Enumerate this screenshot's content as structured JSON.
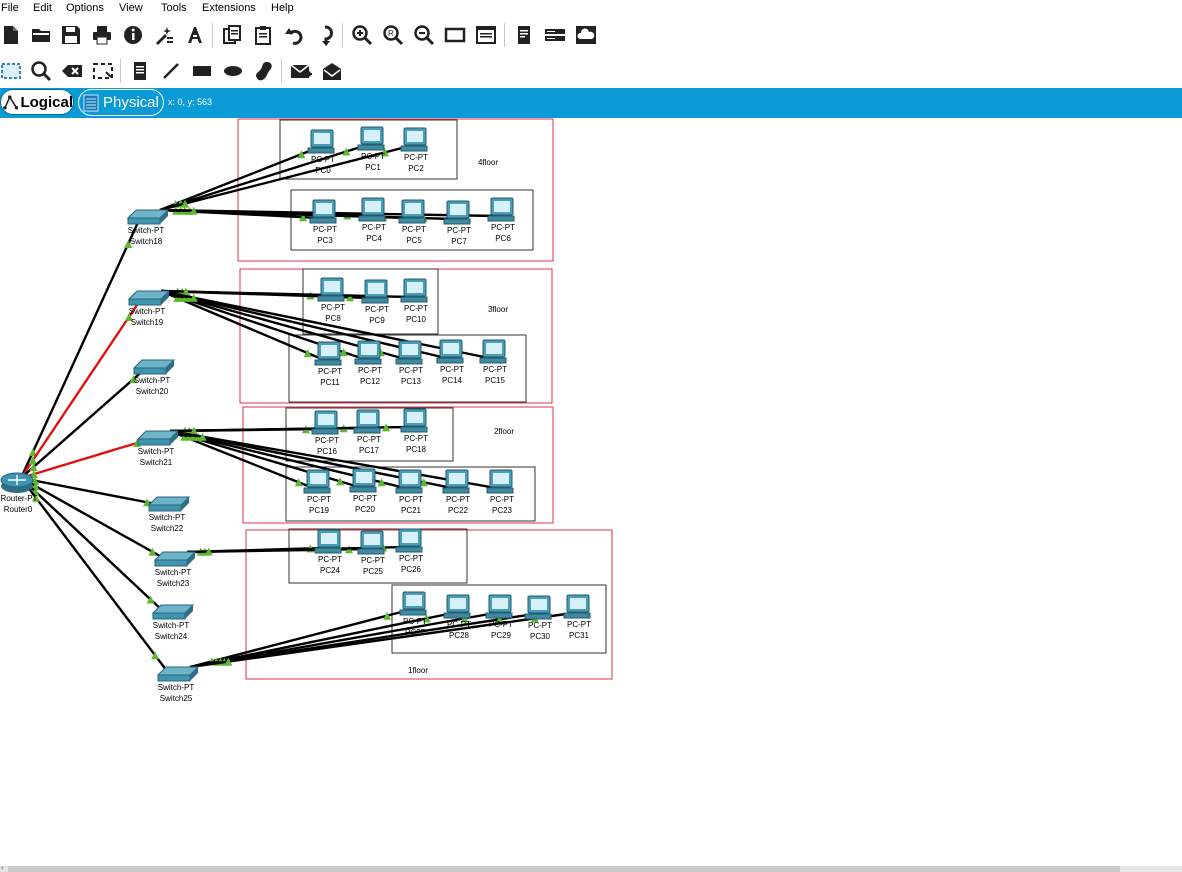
{
  "menu": [
    "File",
    "Edit",
    "Options",
    "View",
    "Tools",
    "Extensions",
    "Help"
  ],
  "toolbar1_icons": [
    "new-file-icon",
    "open-folder-icon",
    "save-icon",
    "print-icon",
    "info-icon",
    "activity-wizard-icon",
    "text-tool-icon",
    "copy-icon",
    "paste-icon",
    "undo-icon",
    "redo-icon",
    "zoom-in-icon",
    "zoom-reset-icon",
    "zoom-out-icon",
    "drawing-palette-icon",
    "custom-device-icon",
    "notes-icon",
    "network-device-icon",
    "cloud-icon"
  ],
  "toolbar2_icons": [
    "select-icon",
    "inspect-icon",
    "delete-icon",
    "resize-icon",
    "note-icon",
    "line-icon",
    "rectangle-icon",
    "ellipse-icon",
    "freeform-icon",
    "simple-pdu-icon",
    "complex-pdu-icon"
  ],
  "tabs": {
    "logical": "Logical",
    "physical": "Physical"
  },
  "coords": "x: 0, y: 563",
  "router": {
    "type": "Router-PT",
    "name": "Router0"
  },
  "switches": [
    {
      "type": "Switch-PT",
      "name": "Switch18"
    },
    {
      "type": "Switch-PT",
      "name": "Switch19"
    },
    {
      "type": "Switch-PT",
      "name": "Switch20"
    },
    {
      "type": "Switch-PT",
      "name": "Switch21"
    },
    {
      "type": "Switch-PT",
      "name": "Switch22"
    },
    {
      "type": "Switch-PT",
      "name": "Switch23"
    },
    {
      "type": "Switch-PT",
      "name": "Switch24"
    },
    {
      "type": "Switch-PT",
      "name": "Switch25"
    }
  ],
  "pc_type": "PC-PT",
  "pcs": [
    "PC0",
    "PC1",
    "PC2",
    "PC3",
    "PC4",
    "PC5",
    "PC7",
    "PC6",
    "PC8",
    "PC9",
    "PC10",
    "PC11",
    "PC12",
    "PC13",
    "PC14",
    "PC15",
    "PC16",
    "PC17",
    "PC18",
    "PC19",
    "PC20",
    "PC21",
    "PC22",
    "PC23",
    "PC24",
    "PC25",
    "PC26",
    "PC27",
    "PC28",
    "PC29",
    "PC30",
    "PC31"
  ],
  "floors": [
    "4floor",
    "3floor",
    "2floor",
    "1floor"
  ],
  "colors": {
    "mode_bar": "#0a9bd7",
    "floor_border": "#e0304a",
    "link_ok": "#000000",
    "link_down": "#e11111",
    "link_light": "#5cb82e",
    "device": "#3f95b0"
  }
}
